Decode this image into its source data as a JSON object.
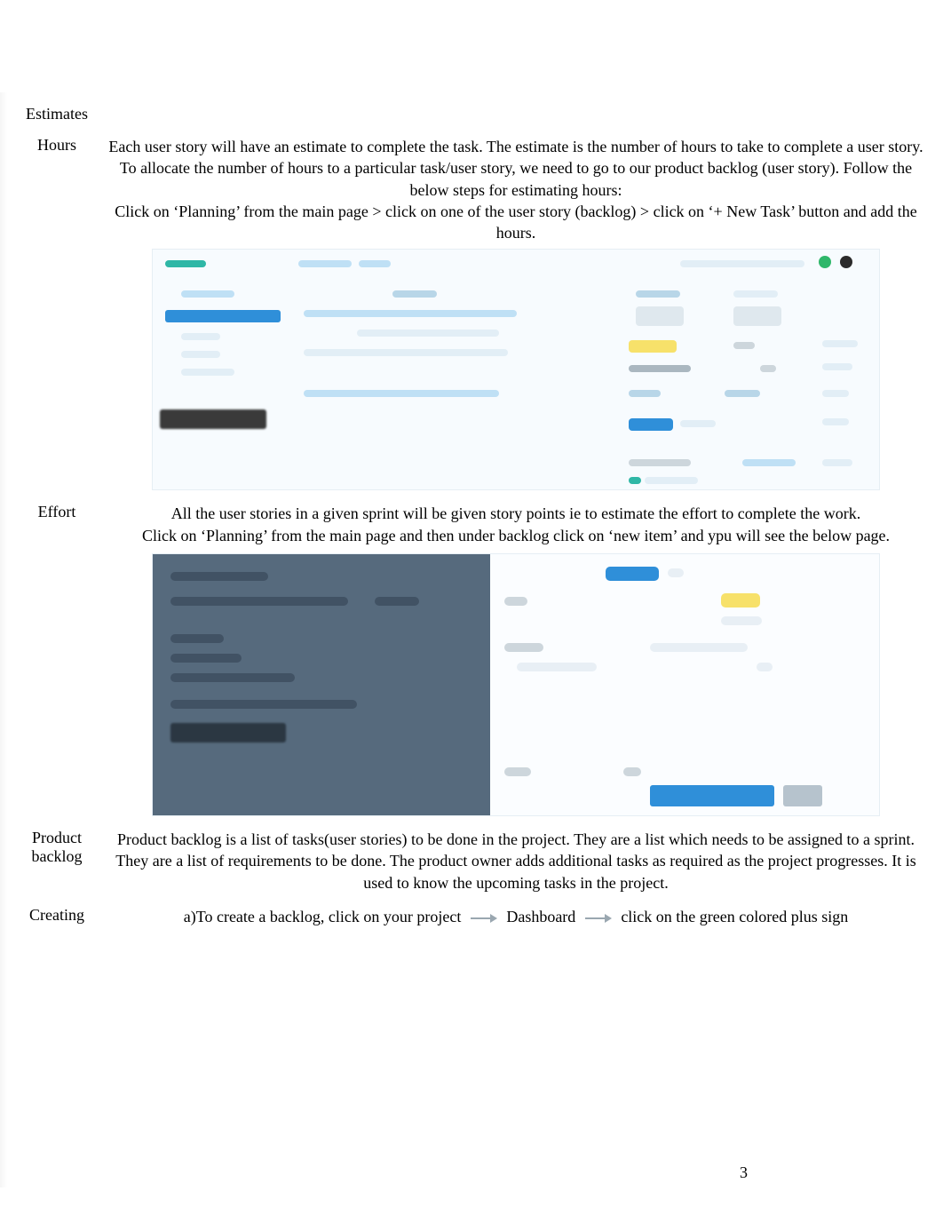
{
  "page_number": "3",
  "rows": {
    "estimates": {
      "label": "Estimates",
      "body": ""
    },
    "hours": {
      "label": "Hours",
      "p1": "Each user story will have an estimate to complete the task. The estimate is the number of hours to take to complete a user story.",
      "p2": "To allocate the number of hours to a particular task/user story, we need to go to our product backlog (user story). Follow the below steps for estimating hours:",
      "p3": "Click on ‘Planning’ from the main page > click on one of the user story (backlog) > click on ‘+ New Task’ button and add the hours."
    },
    "effort": {
      "label": "Effort",
      "p1": "All the user stories in a given sprint will be given story points ie to estimate the effort to complete the work.",
      "p2": "Click on ‘Planning’ from the main page and then under backlog click on ‘new item’ and ypu will see the below page."
    },
    "product_backlog": {
      "label_line1": "Product",
      "label_line2": "backlog",
      "body": "Product backlog is a list of tasks(user stories) to be done in the project. They are a list which needs to be assigned to a sprint. They are a list of requirements to be done. The product owner adds additional tasks as required as the project progresses. It is used to know the upcoming tasks in the project."
    },
    "creating": {
      "label": "Creating",
      "part_a": "a)To create a backlog, click on your project",
      "part_b": "Dashboard",
      "part_c": "click on the green colored plus sign"
    }
  }
}
